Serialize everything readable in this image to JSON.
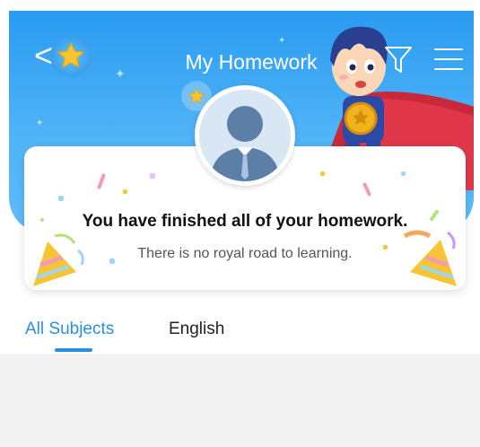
{
  "header": {
    "title": "My Homework",
    "back_icon": "back-chevron-icon",
    "star_icon": "star-icon",
    "filter_icon": "filter-icon",
    "menu_icon": "menu-icon"
  },
  "card": {
    "headline": "You have finished all of your homework.",
    "subline": "There is no royal road to learning."
  },
  "tabs": [
    {
      "label": "All Subjects",
      "active": true
    },
    {
      "label": "English",
      "active": false
    }
  ],
  "colors": {
    "accent": "#2a8fe0",
    "header_blue": "#2a9bf1",
    "star_yellow": "#f7c533"
  }
}
